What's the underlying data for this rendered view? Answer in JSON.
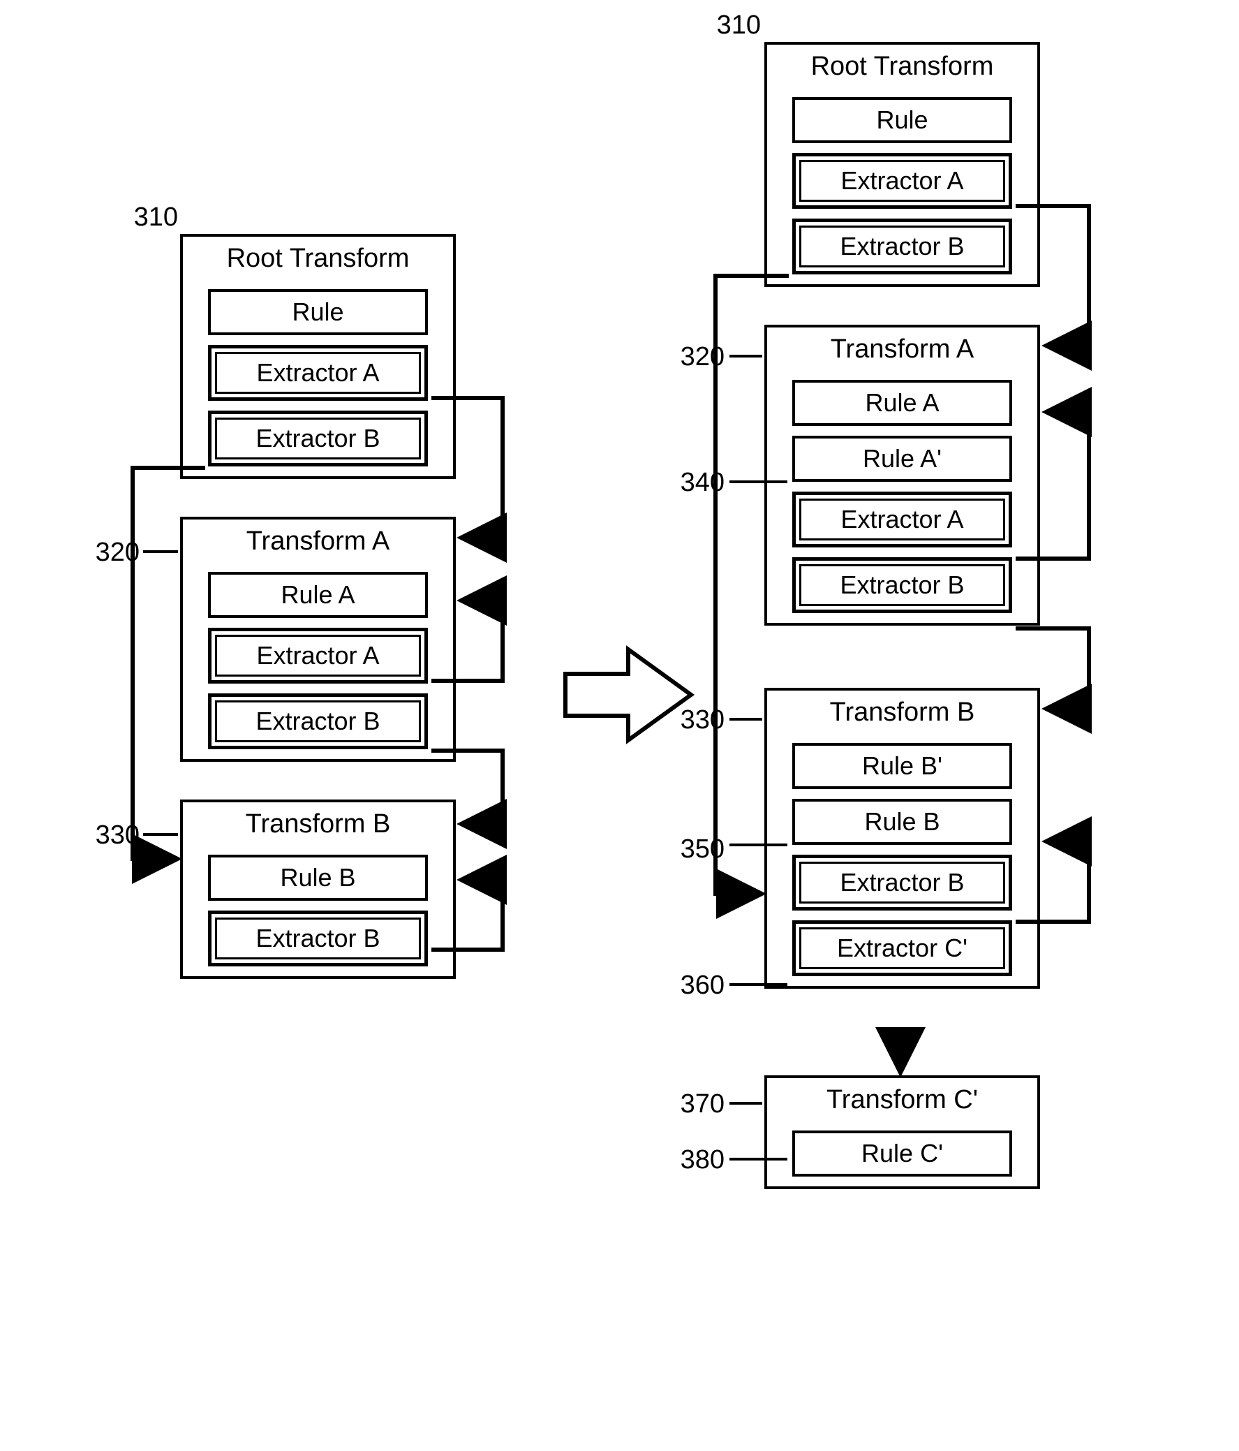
{
  "left": {
    "root": {
      "ref": "310",
      "title": "Root Transform",
      "items": [
        {
          "type": "single",
          "label": "Rule"
        },
        {
          "type": "double",
          "label": "Extractor A"
        },
        {
          "type": "double",
          "label": "Extractor B"
        }
      ]
    },
    "transformA": {
      "ref": "320",
      "title": "Transform A",
      "items": [
        {
          "type": "single",
          "label": "Rule A"
        },
        {
          "type": "double",
          "label": "Extractor A"
        },
        {
          "type": "double",
          "label": "Extractor B"
        }
      ]
    },
    "transformB": {
      "ref": "330",
      "title": "Transform B",
      "items": [
        {
          "type": "single",
          "label": "Rule B"
        },
        {
          "type": "double",
          "label": "Extractor B"
        }
      ]
    }
  },
  "right": {
    "root": {
      "ref": "310",
      "title": "Root Transform",
      "items": [
        {
          "type": "single",
          "label": "Rule"
        },
        {
          "type": "double",
          "label": "Extractor A"
        },
        {
          "type": "double",
          "label": "Extractor B"
        }
      ]
    },
    "transformA": {
      "ref": "320",
      "ref2": "340",
      "title": "Transform A",
      "items": [
        {
          "type": "single",
          "label": "Rule A"
        },
        {
          "type": "single",
          "label": "Rule A'"
        },
        {
          "type": "double",
          "label": "Extractor A"
        },
        {
          "type": "double",
          "label": "Extractor B"
        }
      ]
    },
    "transformB": {
      "ref": "330",
      "ref2": "350",
      "ref3": "360",
      "title": "Transform B",
      "items": [
        {
          "type": "single",
          "label": "Rule B'"
        },
        {
          "type": "single",
          "label": "Rule B"
        },
        {
          "type": "double",
          "label": "Extractor B"
        },
        {
          "type": "double",
          "label": "Extractor C'"
        }
      ]
    },
    "transformC": {
      "ref": "370",
      "ref2": "380",
      "title": "Transform C'",
      "items": [
        {
          "type": "single",
          "label": "Rule C'"
        }
      ]
    }
  }
}
